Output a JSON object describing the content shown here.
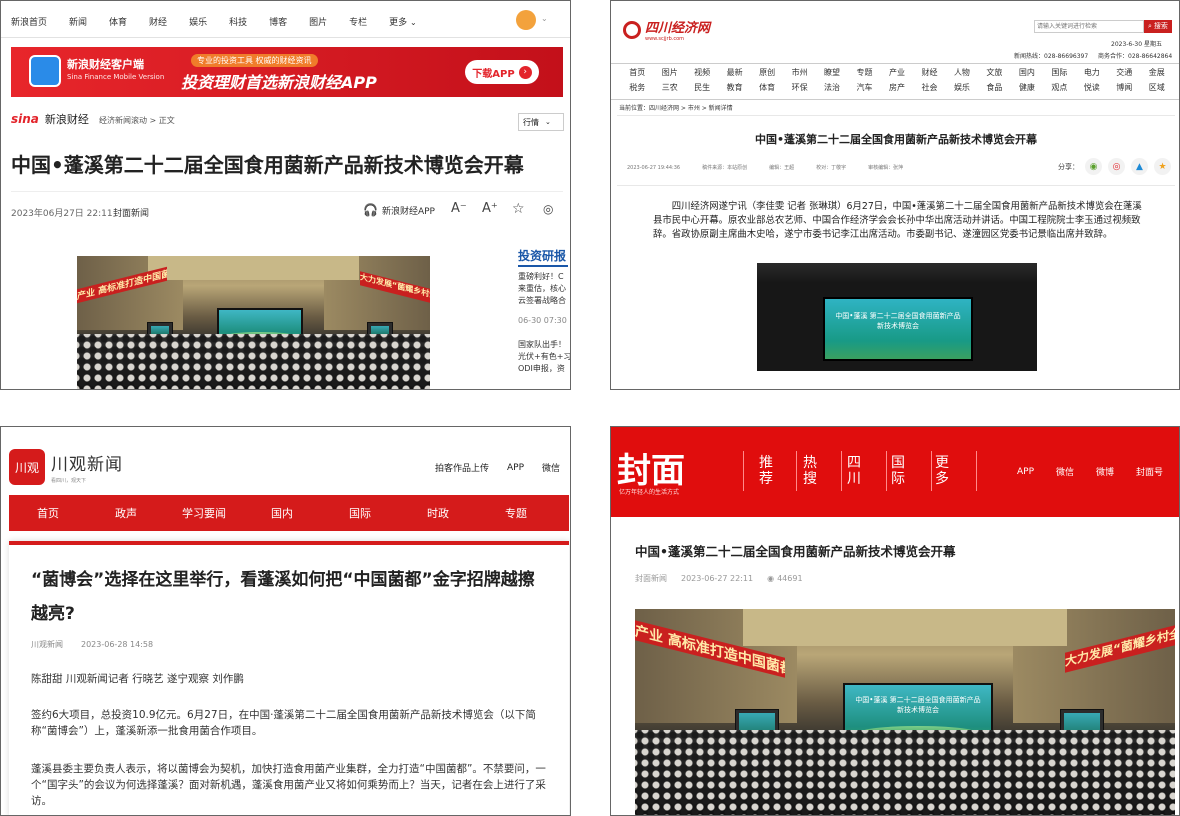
{
  "colors": {
    "sina_red": "#e3242b",
    "fengmian_red": "#e00d0d",
    "chuanguan_red": "#d51b1b",
    "sichuan_red": "#c9201f"
  },
  "p1": {
    "nav": [
      "新浪首页",
      "新闻",
      "体育",
      "财经",
      "娱乐",
      "科技",
      "博客",
      "图片",
      "专栏",
      "更多"
    ],
    "banner": {
      "title": "新浪财经客户端",
      "subtitle": "Sina Finance Mobile Version",
      "tagline": "专业的投资工具 权威的财经资讯",
      "slogan": "投资理财首选新浪财经APP",
      "button": "下载APP"
    },
    "brand": "新浪财经",
    "breadcrumb": "经济新闻滚动 > 正文",
    "dropdown": "行情",
    "title": "中国•蓬溪第二十二届全国食用菌新产品新技术博览会开幕",
    "date": "2023年06月27日 22:11",
    "source": "封面新闻",
    "app_link": "新浪财经APP",
    "side_title": "投资研报",
    "side_items": [
      "重磅利好！C",
      "来重估，核心",
      "云签署战略合",
      "06-30 07:30",
      "国家队出手！",
      "光伏+有色+习",
      "ODI申报，资"
    ]
  },
  "p2": {
    "logo": "四川经济网",
    "logo_url": "www.scjjrb.com",
    "search_placeholder": "请输入关键词进行检索",
    "search_btn": "搜索",
    "date": "2023-6-30 星期五",
    "hotline": "新闻热线：028-86696397",
    "bizline": "商务合作：028-86642864",
    "nav_row1": [
      "首页",
      "图片",
      "视频",
      "最新",
      "原创",
      "市州",
      "瞭望",
      "专题",
      "产业",
      "财经",
      "人物",
      "文旅",
      "国内",
      "国际",
      "电力",
      "交通",
      "金展"
    ],
    "nav_row2": [
      "税务",
      "三农",
      "民生",
      "教育",
      "体育",
      "环保",
      "法治",
      "汽车",
      "房产",
      "社会",
      "娱乐",
      "食品",
      "健康",
      "观点",
      "悦读",
      "博闻",
      "区域"
    ],
    "breadcrumb": "当前位置：四川经济网 > 市州 > 新闻详情",
    "title": "中国•蓬溪第二十二届全国食用菌新产品新技术博览会开幕",
    "meta": {
      "time": "2023-06-27 19:44:36",
      "source": "稿件来源：本站原创",
      "editor": "编辑：王超",
      "review": "校对：丁敬宇",
      "final": "审核编辑：张萍",
      "share": "分享："
    },
    "body": "四川经济网遂宁讯（李佳雯 记者 张琳琪）6月27日，中国•蓬溪第二十二届全国食用菌新产品新技术博览会在蓬溪县市民中心开幕。原农业部总农艺师、中国合作经济学会会长孙中华出席活动并讲话。中国工程院院士李玉通过视频致辞。省政协原副主席曲木史哈，遂宁市委书记李江出席活动。市委副书记、遂潼园区党委书记景临出席并致辞。",
    "screen_text": "中国•蓬溪 第二十二届全国食用菌新产品新技术博览会"
  },
  "p3": {
    "logo_mark": "川观",
    "logo_text": "川观新闻",
    "logo_sub": "看四川，观天下",
    "top_links": [
      "拍客作品上传",
      "APP",
      "微信"
    ],
    "nav": [
      "首页",
      "政声",
      "学习要闻",
      "国内",
      "国际",
      "时政",
      "专题"
    ],
    "title": "“菌博会”选择在这里举行，看蓬溪如何把“中国菌都”金字招牌越擦越亮?",
    "source": "川观新闻",
    "date": "2023-06-28 14:58",
    "authors": "陈甜甜 川观新闻记者 行晓艺 遂宁观察 刘作鹏",
    "para1": "签约6大项目，总投资10.9亿元。6月27日，在中国·蓬溪第二十二届全国食用菌新产品新技术博览会（以下简称“菌博会”）上，蓬溪新添一批食用菌合作项目。",
    "para2": "蓬溪县委主要负责人表示，将以菌博会为契机，加快打造食用菌产业集群，全力打造“中国菌都”。不禁要问，一个“国字头”的会议为何选择蓬溪？面对新机遇，蓬溪食用菌产业又将如何乘势而上？当天，记者在会上进行了采访。"
  },
  "p4": {
    "logo": "封面",
    "slogan": "亿万年轻人的生活方式",
    "nav": [
      "推荐",
      "热搜",
      "四川",
      "国际",
      "更多"
    ],
    "links": [
      "APP",
      "微信",
      "微博",
      "封面号"
    ],
    "title": "中国•蓬溪第二十二届全国食用菌新产品新技术博览会开幕",
    "source": "封面新闻",
    "date": "2023-06-27 22:11",
    "views": "44691",
    "banner_left": "产业  高标准打造中国菌都",
    "banner_right": "大力发展“菌耀乡村全面振兴",
    "screen_text": "中国•蓬溪 第二十二届全国食用菌新产品新技术博览会"
  }
}
